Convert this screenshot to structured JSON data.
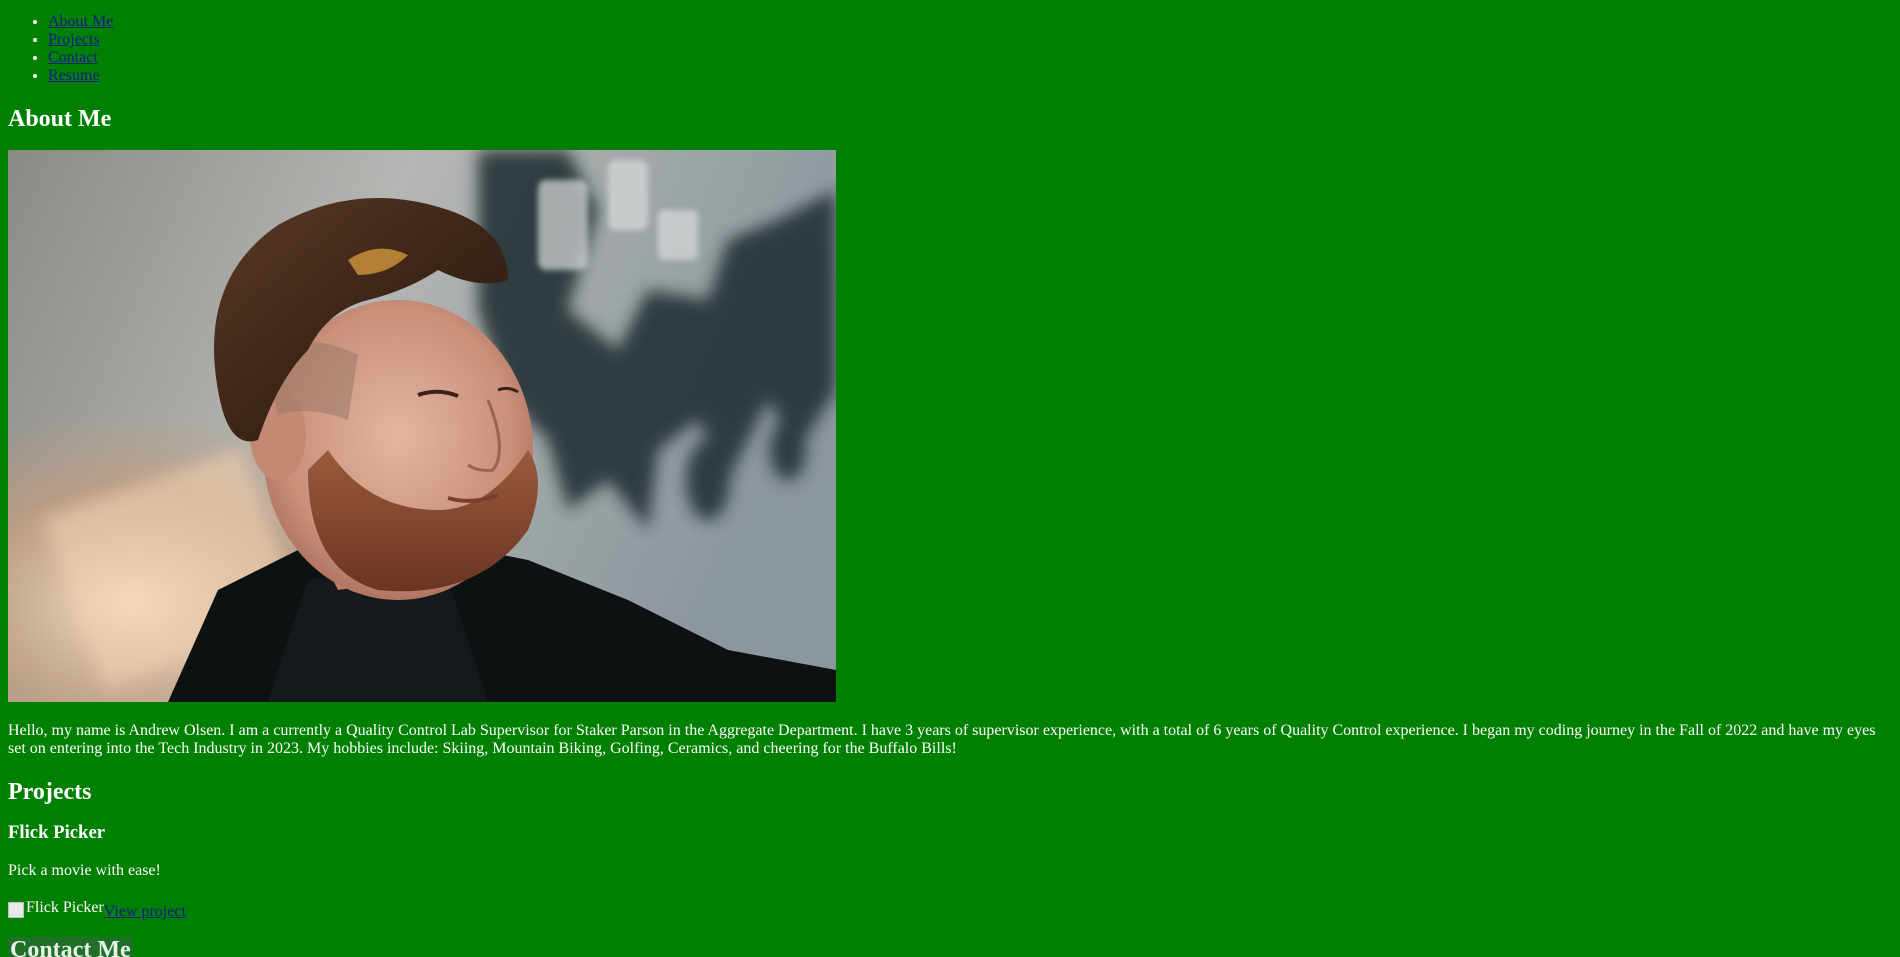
{
  "nav": {
    "items": [
      {
        "label": "About Me"
      },
      {
        "label": "Projects"
      },
      {
        "label": "Contact"
      },
      {
        "label": "Resume"
      }
    ]
  },
  "about": {
    "heading": "About Me",
    "photo_alt": "",
    "bio": "Hello, my name is Andrew Olsen. I am a currently a Quality Control Lab Supervisor for Staker Parson in the Aggregate Department. I have 3 years of supervisor experience, with a total of 6 years of Quality Control experience. I began my coding journey in the Fall of 2022 and have my eyes set on entering into the Tech Industry in 2023. My hobbies include: Skiing, Mountain Biking, Golfing, Ceramics, and cheering for the Buffalo Bills!"
  },
  "projects": {
    "heading": "Projects",
    "items": [
      {
        "title": "Flick Picker",
        "description": "Pick a movie with ease!",
        "image_alt": "Flick Picker",
        "link_label": "View project"
      }
    ]
  },
  "contact": {
    "heading": "Contact Me"
  },
  "colors": {
    "page_background": "#008000",
    "text": "#ffffff",
    "link": "#1a1a8c"
  }
}
